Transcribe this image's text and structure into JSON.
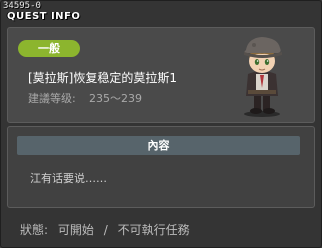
{
  "window": {
    "quest_id": "34595-0",
    "title": "QUEST INFO"
  },
  "quest": {
    "category_badge": "一般",
    "name": "[莫拉斯]恢复稳定的莫拉斯1",
    "level_label": "建議等级:",
    "level_range": "235～239",
    "npc_icon": "npc-boy-portrait"
  },
  "content": {
    "header": "內容",
    "text": "江有话要说……"
  },
  "status": {
    "label": "狀態:",
    "start": "可開始",
    "separator": "/",
    "execute": "不可執行任務"
  },
  "colors": {
    "badge": "#8cb52e",
    "content_header": "#57646b",
    "background": "#343434"
  }
}
